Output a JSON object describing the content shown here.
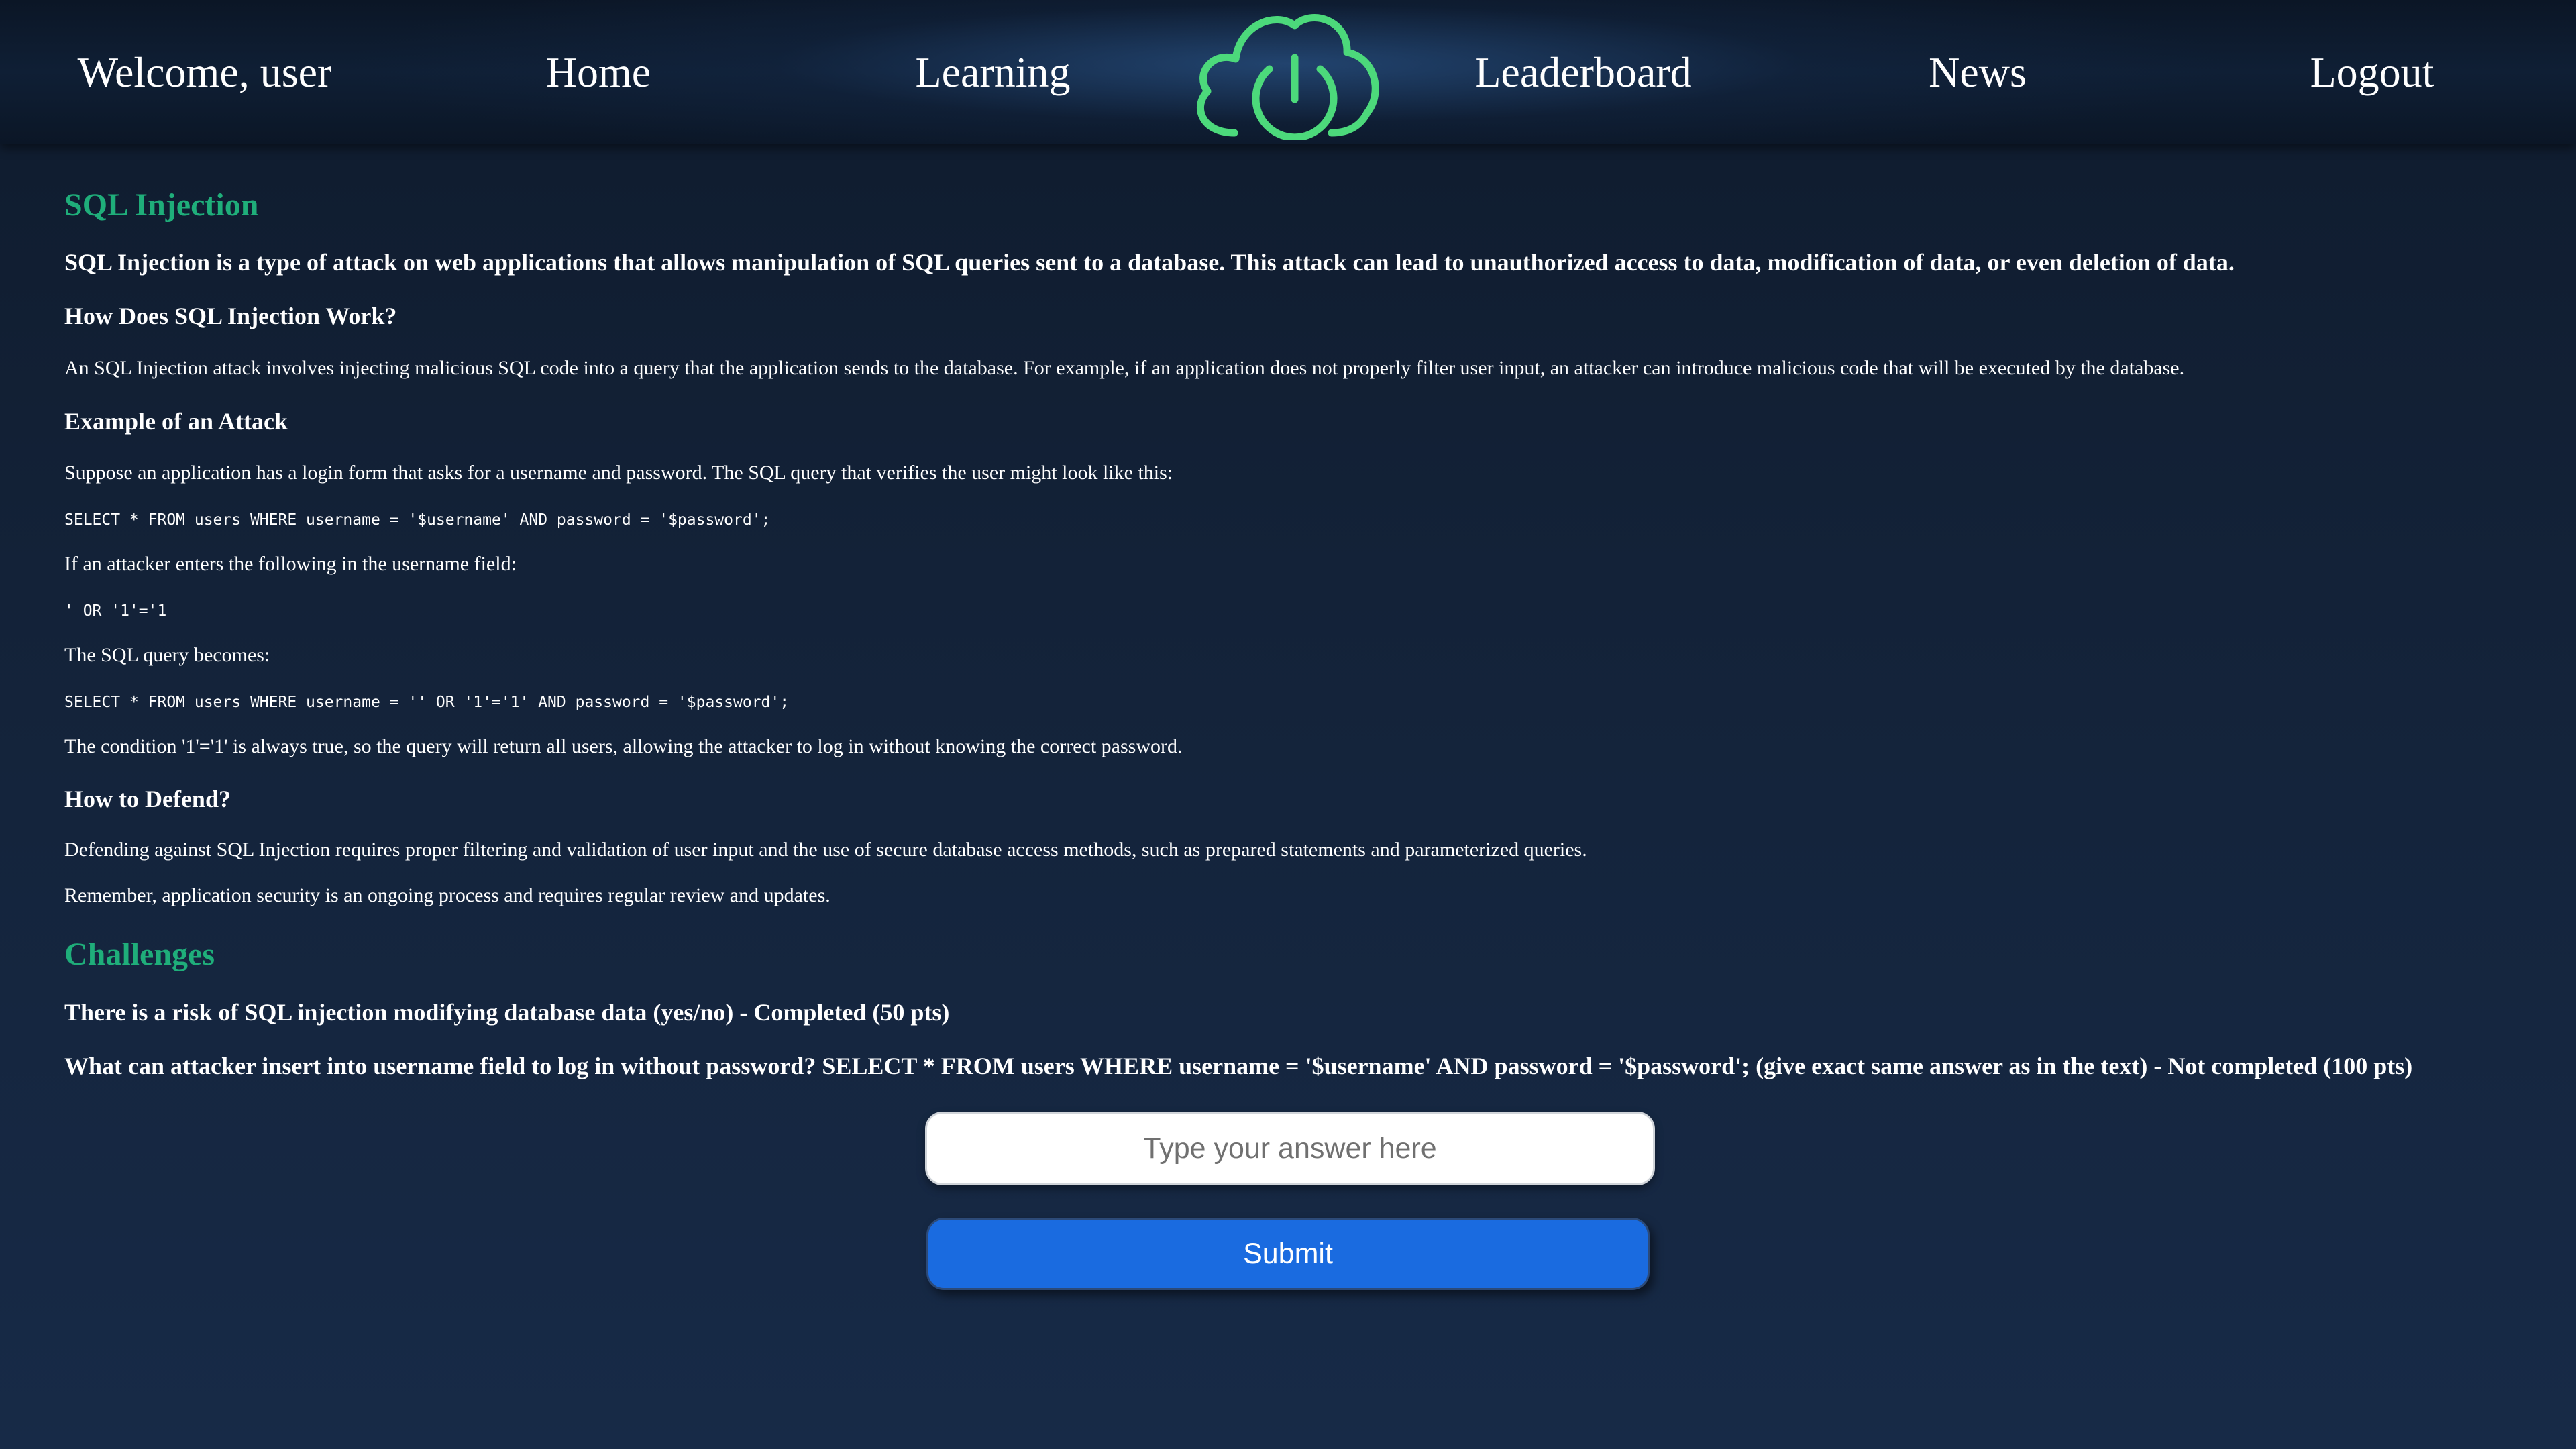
{
  "nav": {
    "welcome": "Welcome, user",
    "home": "Home",
    "learning": "Learning",
    "leaderboard": "Leaderboard",
    "news": "News",
    "logout": "Logout",
    "logo_icon": "cloud-power-icon"
  },
  "article": {
    "title": "SQL Injection",
    "intro": "SQL Injection is a type of attack on web applications that allows manipulation of SQL queries sent to a database. This attack can lead to unauthorized access to data, modification of data, or even deletion of data.",
    "how_heading": "How Does SQL Injection Work?",
    "how_text": "An SQL Injection attack involves injecting malicious SQL code into a query that the application sends to the database. For example, if an application does not properly filter user input, an attacker can introduce malicious code that will be executed by the database.",
    "example_heading": "Example of an Attack",
    "example_text": "Suppose an application has a login form that asks for a username and password. The SQL query that verifies the user might look like this:",
    "code_query": "SELECT * FROM users WHERE username = '$username' AND password = '$password';",
    "attacker_text": "If an attacker enters the following in the username field:",
    "code_payload": "' OR '1'='1",
    "becomes_text": "The SQL query becomes:",
    "code_result": "SELECT * FROM users WHERE username = '' OR '1'='1' AND password = '$password';",
    "condition_text": "The condition '1'='1' is always true, so the query will return all users, allowing the attacker to log in without knowing the correct password.",
    "defend_heading": "How to Defend?",
    "defend_text": "Defending against SQL Injection requires proper filtering and validation of user input and the use of secure database access methods, such as prepared statements and parameterized queries.",
    "remember_text": "Remember, application security is an ongoing process and requires regular review and updates."
  },
  "challenges": {
    "title": "Challenges",
    "items": [
      {
        "text": "There is a risk of SQL injection modifying database data (yes/no) - Completed (50 pts)"
      },
      {
        "text": "What can attacker insert into username field to log in without password? SELECT * FROM users WHERE username = '$username' AND password = '$password'; (give exact same answer as in the text) - Not completed (100 pts)"
      }
    ],
    "answer_placeholder": "Type your answer here",
    "submit_label": "Submit"
  },
  "colors": {
    "accent_green": "#1fae7a",
    "logo_green": "#4cd97b",
    "submit_blue": "#1a6be0",
    "background": "#132238"
  }
}
